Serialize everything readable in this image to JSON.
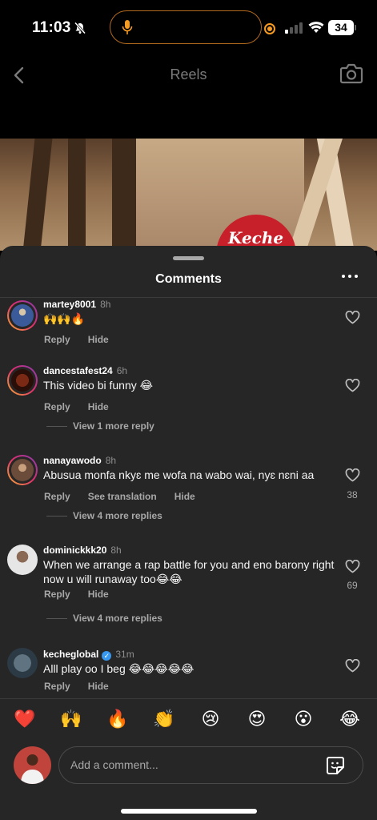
{
  "status_bar": {
    "time": "11:03",
    "battery": "34"
  },
  "header": {
    "title": "Reels"
  },
  "video": {
    "cap_text": "Keche"
  },
  "sheet": {
    "title": "Comments",
    "comments": [
      {
        "username": "martey8001",
        "ago": "8h",
        "text": "🙌🙌🔥",
        "actions": [
          "Reply",
          "Hide"
        ],
        "likes": "",
        "view_more": ""
      },
      {
        "username": "dancestafest24",
        "ago": "6h",
        "text": "This video bi funny 😂",
        "actions": [
          "Reply",
          "Hide"
        ],
        "likes": "",
        "view_more": "View 1 more reply"
      },
      {
        "username": "nanayawodo",
        "ago": "8h",
        "text": "Abusua monfa nkyɛ me wofa na wabo wai, nyɛ nɛni aa",
        "actions": [
          "Reply",
          "See translation",
          "Hide"
        ],
        "likes": "38",
        "view_more": "View 4 more replies"
      },
      {
        "username": "dominickkk20",
        "ago": "8h",
        "text": "When we arrange a rap battle for you and eno barony right now  u will runaway too😂😂",
        "actions": [
          "Reply",
          "Hide"
        ],
        "likes": "69",
        "view_more": "View 4 more replies"
      },
      {
        "username": "kecheglobal",
        "ago": "31m",
        "text": "Alll play oo I beg 😂😂😂😂😂",
        "actions": [
          "Reply",
          "Hide"
        ],
        "likes": "",
        "view_more": ""
      }
    ],
    "reactions": [
      "❤️",
      "🙌",
      "🔥",
      "👏",
      "😢",
      "😍",
      "😮",
      "😂"
    ],
    "input_placeholder": "Add a comment..."
  }
}
